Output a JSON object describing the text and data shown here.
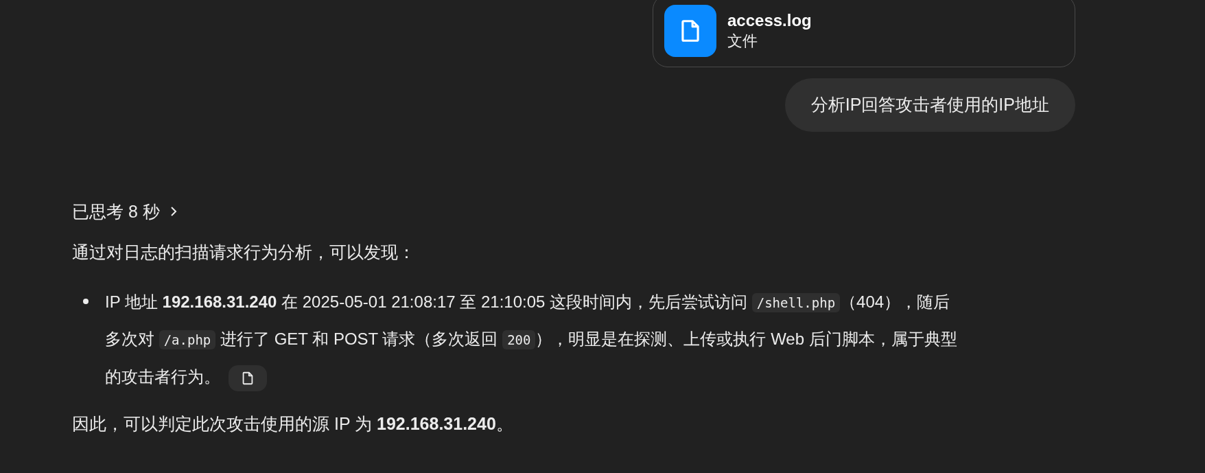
{
  "attachment": {
    "name": "access.log",
    "type": "文件"
  },
  "user_message": "分析IP回答攻击者使用的IP地址",
  "thinking": {
    "label": "已思考 8 秒",
    "expanded": false
  },
  "intro": "通过对日志的扫描请求行为分析，可以发现：",
  "bullets": [
    {
      "segments": [
        {
          "kind": "text",
          "text": "IP 地址 "
        },
        {
          "kind": "bold",
          "text": "192.168.31.240"
        },
        {
          "kind": "text",
          "text": " 在 2025-05-01 21:08:17 至 21:10:05 这段时间内，先后尝试访问 "
        },
        {
          "kind": "code",
          "text": "/shell.php"
        },
        {
          "kind": "text",
          "text": "（404），随后多次对 "
        },
        {
          "kind": "code",
          "text": "/a.php"
        },
        {
          "kind": "text",
          "text": " 进行了 GET 和 POST 请求（多次返回 "
        },
        {
          "kind": "code",
          "text": "200"
        },
        {
          "kind": "text",
          "text": "），明显是在探测、上传或执行 Web 后门脚本，属于典型的攻击者行为。"
        }
      ]
    }
  ],
  "conclusion": "因此，可以判定此次攻击使用的源 IP 为 **192.168.31.240**。"
}
